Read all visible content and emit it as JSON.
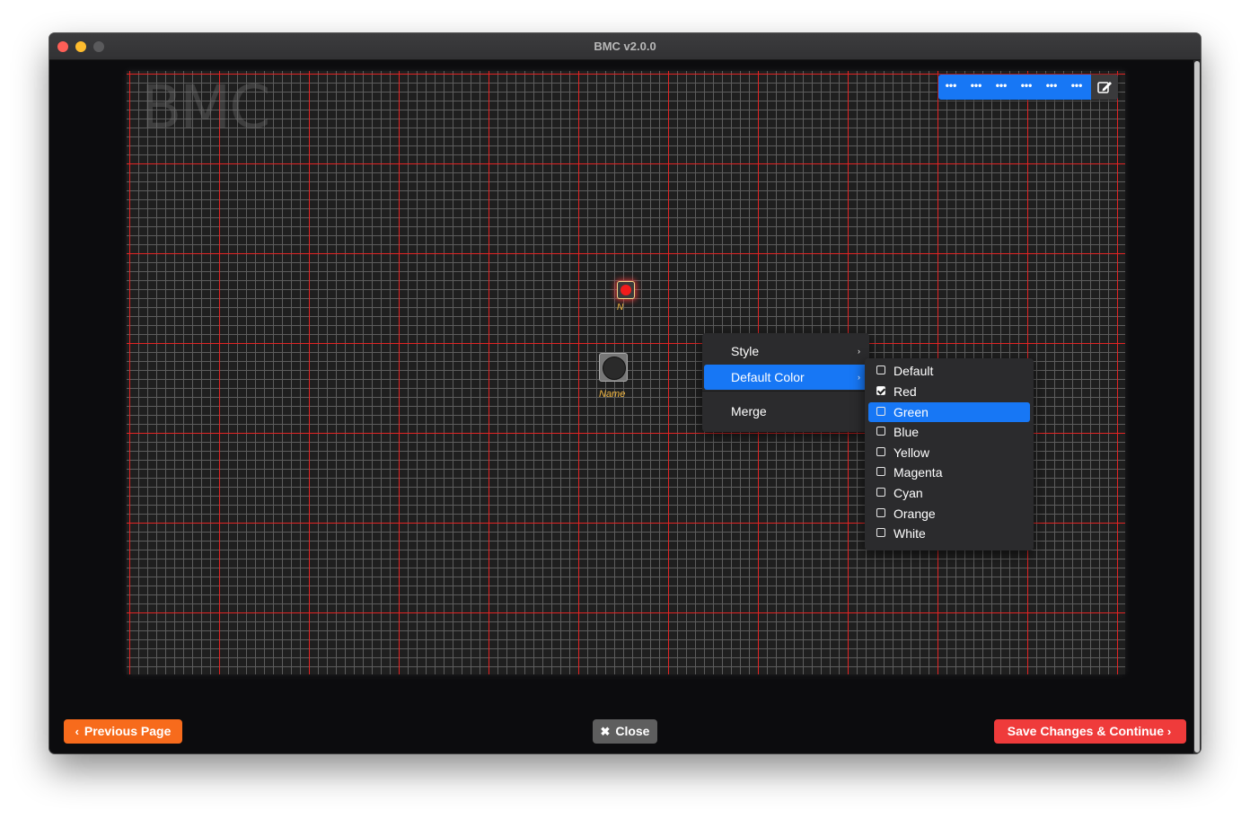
{
  "window": {
    "title": "BMC v2.0.0"
  },
  "canvas": {
    "watermark": "BMC"
  },
  "toolbar": {
    "dots": [
      "•••",
      "•••",
      "•••",
      "•••",
      "•••",
      "•••"
    ],
    "edit_icon": "edit-icon"
  },
  "nodes": {
    "led_label": "N",
    "button_label": "Name"
  },
  "context_menu": {
    "items": [
      {
        "label": "Style",
        "has_submenu": true
      },
      {
        "label": "Default Color",
        "has_submenu": true,
        "active": true
      },
      {
        "label": "Merge",
        "has_submenu": false
      }
    ],
    "submenu_arrow": "›"
  },
  "color_submenu": {
    "items": [
      {
        "label": "Default",
        "checked": false
      },
      {
        "label": "Red",
        "checked": true
      },
      {
        "label": "Green",
        "checked": false,
        "highlighted": true
      },
      {
        "label": "Blue",
        "checked": false
      },
      {
        "label": "Yellow",
        "checked": false
      },
      {
        "label": "Magenta",
        "checked": false
      },
      {
        "label": "Cyan",
        "checked": false
      },
      {
        "label": "Orange",
        "checked": false
      },
      {
        "label": "White",
        "checked": false
      }
    ]
  },
  "footer": {
    "previous_label": "Previous Page",
    "previous_glyph": "‹",
    "close_label": "Close",
    "close_glyph": "✖",
    "save_label": "Save Changes & Continue",
    "save_glyph": "›"
  },
  "colors": {
    "accent": "#1777f5",
    "grid_major": "#f01e1e",
    "previous_button": "#f76b1c",
    "save_button": "#ef3b3b",
    "close_button": "#5e5e5e"
  }
}
